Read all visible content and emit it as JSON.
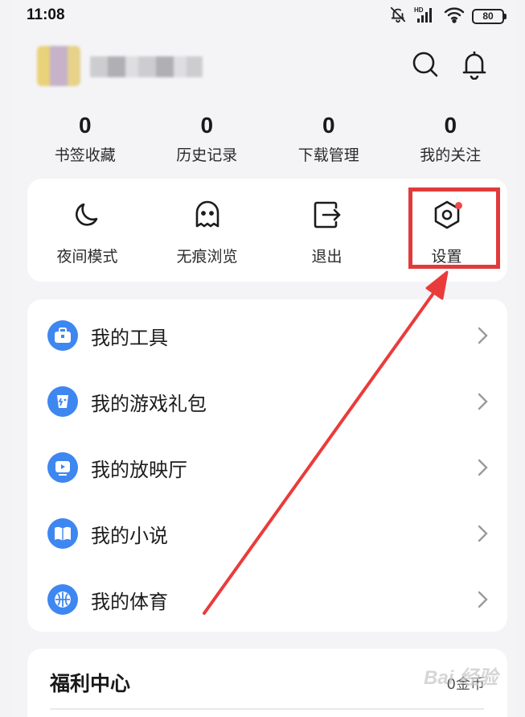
{
  "status_bar": {
    "time": "11:08",
    "battery": "80",
    "icons": [
      "bell-off-icon",
      "hd-signal-icon",
      "wifi-icon",
      "battery-icon"
    ]
  },
  "header": {
    "icons": [
      "search-icon",
      "bell-icon"
    ]
  },
  "stats": [
    {
      "value": "0",
      "label": "书签收藏"
    },
    {
      "value": "0",
      "label": "历史记录"
    },
    {
      "value": "0",
      "label": "下载管理"
    },
    {
      "value": "0",
      "label": "我的关注"
    }
  ],
  "quick_actions": [
    {
      "label": "夜间模式",
      "icon": "moon-icon"
    },
    {
      "label": "无痕浏览",
      "icon": "ghost-icon"
    },
    {
      "label": "退出",
      "icon": "logout-icon"
    },
    {
      "label": "设置",
      "icon": "settings-icon"
    }
  ],
  "menu": [
    {
      "label": "我的工具",
      "icon": "toolbox-icon"
    },
    {
      "label": "我的游戏礼包",
      "icon": "game-gift-icon"
    },
    {
      "label": "我的放映厅",
      "icon": "play-screen-icon"
    },
    {
      "label": "我的小说",
      "icon": "book-icon"
    },
    {
      "label": "我的体育",
      "icon": "basketball-icon"
    }
  ],
  "welfare": {
    "title": "福利中心",
    "coins": "0金币"
  },
  "watermark": "Bai 经验",
  "colors": {
    "accent_blue": "#3e87f0",
    "highlight_red": "#e23a3a",
    "background": "#f4f4f7",
    "card": "#ffffff"
  }
}
